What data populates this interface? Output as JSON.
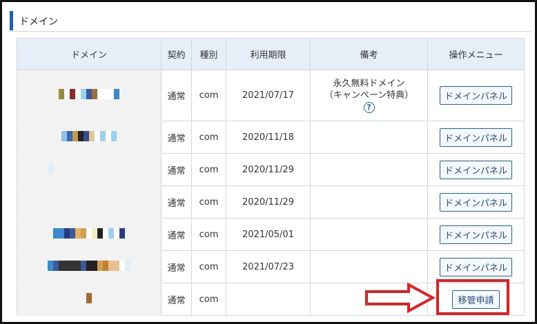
{
  "section": {
    "title": "ドメイン"
  },
  "table": {
    "headers": [
      "ドメイン",
      "契約",
      "種別",
      "利用期限",
      "備考",
      "操作メニュー"
    ],
    "rows": [
      {
        "contract": "通常",
        "type": "com",
        "expiry": "2021/07/17",
        "note_line1": "永久無料ドメイン",
        "note_line2": "（キャンペーン特典）",
        "action": "ドメインパネル"
      },
      {
        "contract": "通常",
        "type": "com",
        "expiry": "2020/11/18",
        "action": "ドメインパネル"
      },
      {
        "contract": "通常",
        "type": "com",
        "expiry": "2020/11/29",
        "action": "ドメインパネル"
      },
      {
        "contract": "通常",
        "type": "com",
        "expiry": "2020/11/29",
        "action": "ドメインパネル"
      },
      {
        "contract": "通常",
        "type": "com",
        "expiry": "2021/05/01",
        "action": "ドメインパネル"
      },
      {
        "contract": "通常",
        "type": "com",
        "expiry": "2021/07/23",
        "action": "ドメインパネル"
      },
      {
        "contract": "通常",
        "type": "com",
        "expiry": "",
        "action": "移管申請"
      }
    ],
    "help_icon": "?"
  },
  "colors": {
    "accent": "#1e63b3",
    "highlight": "#e02020",
    "header_bg": "#e6eef8"
  }
}
